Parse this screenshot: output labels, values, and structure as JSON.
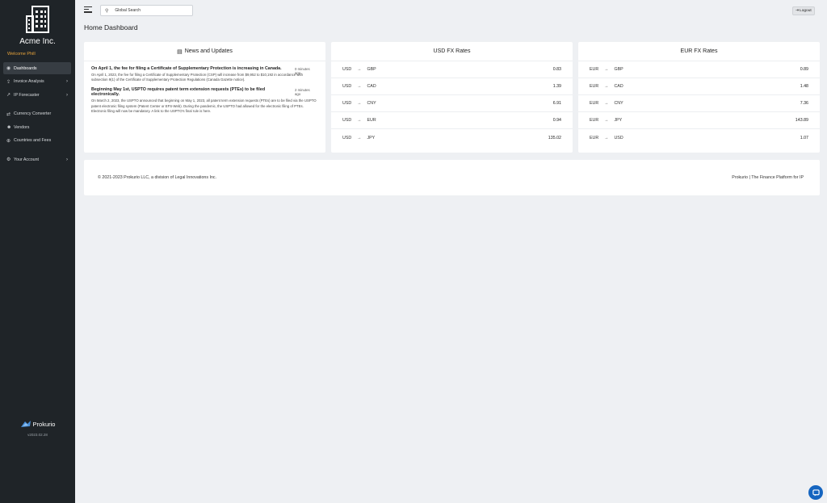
{
  "sidebar": {
    "company": "Acme Inc.",
    "welcome": "Welcome Phill",
    "items": [
      {
        "label": "Dashboards"
      },
      {
        "label": "Invoice Analysis"
      },
      {
        "label": "IP Forecaster"
      },
      {
        "label": "Currency Converter"
      },
      {
        "label": "Vendors"
      },
      {
        "label": "Countries and Fees"
      },
      {
        "label": "Your Account"
      }
    ],
    "brand": "Prokurio",
    "version": "v2023.02.28"
  },
  "header": {
    "search_placeholder": "Global Search",
    "logout_label": "Logout"
  },
  "page": {
    "title": "Home Dashboard"
  },
  "news": {
    "title": "News and Updates",
    "items": [
      {
        "headline": "On April 1, the fee for filing a Certificate of Supplementary Protection is increasing in Canada.",
        "time": "0 minutes ago",
        "body": "On April 1, 2023, the fee for filing a Certificate of Supplementary Protection (CSP) will increase from $9,952 to $10,192 in accordance with subsection 9(1) of the Certificate of Supplementary Protection Regulations (Canada Gazette notice)."
      },
      {
        "headline": "Beginning May 1st, USPTO requires patent term extension requests (PTEs) to be filed electronically.",
        "time": "2 minutes ago",
        "body": "On March 2, 2023, the USPTO announced that beginning on May 1, 2023, all patent term extension requests (PTEs) are to be filed via the USPTO patent electronic filing system (Patent Center or EFS-Web). During the pandemic, the USPTO had allowed for the electronic filing of PTEs. Electronic filing will now be mandatory. A link to the USPTO's final rule is here."
      }
    ]
  },
  "usd_fx": {
    "title": "USD FX Rates",
    "rows": [
      {
        "from": "USD",
        "to": "GBP",
        "value": "0.83"
      },
      {
        "from": "USD",
        "to": "CAD",
        "value": "1.39"
      },
      {
        "from": "USD",
        "to": "CNY",
        "value": "6.91"
      },
      {
        "from": "USD",
        "to": "EUR",
        "value": "0.94"
      },
      {
        "from": "USD",
        "to": "JPY",
        "value": "135.02"
      }
    ]
  },
  "eur_fx": {
    "title": "EUR FX Rates",
    "rows": [
      {
        "from": "EUR",
        "to": "GBP",
        "value": "0.89"
      },
      {
        "from": "EUR",
        "to": "CAD",
        "value": "1.48"
      },
      {
        "from": "EUR",
        "to": "CNY",
        "value": "7.36"
      },
      {
        "from": "EUR",
        "to": "JPY",
        "value": "143.89"
      },
      {
        "from": "EUR",
        "to": "USD",
        "value": "1.07"
      }
    ]
  },
  "footer": {
    "left": "© 2021-2023 Prokurio LLC, a division of Legal Innovations Inc.",
    "right": "Prokurio | The Finance Platform for IP"
  },
  "colors": {
    "sidebar_bg": "#1f2428",
    "welcome": "#e7a33b",
    "chat_button": "#1565c0"
  }
}
